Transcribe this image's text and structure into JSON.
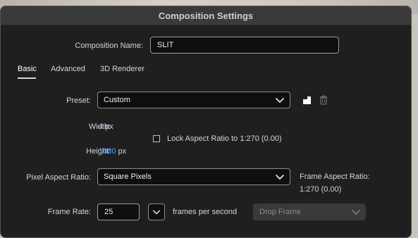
{
  "window": {
    "title": "Composition Settings"
  },
  "composition": {
    "name_label": "Composition Name:",
    "name_value": "SLIT"
  },
  "tabs": [
    {
      "label": "Basic",
      "active": true
    },
    {
      "label": "Advanced",
      "active": false
    },
    {
      "label": "3D Renderer",
      "active": false
    }
  ],
  "preset": {
    "label": "Preset:",
    "value": "Custom",
    "save_icon": "save-preset-icon",
    "delete_icon": "trash-icon"
  },
  "size": {
    "width_label": "Width:",
    "width_value": "4",
    "width_unit": "px",
    "height_label": "Height:",
    "height_value": "1080",
    "height_unit": "px",
    "lock_label": "Lock Aspect Ratio to 1:270 (0.00)",
    "lock_checked": false
  },
  "pixel_aspect": {
    "label": "Pixel Aspect Ratio:",
    "value": "Square Pixels"
  },
  "frame_aspect": {
    "label": "Frame Aspect Ratio:",
    "value": "1:270 (0.00)"
  },
  "frame_rate": {
    "label": "Frame Rate:",
    "value": "25",
    "units": "frames per second",
    "drop_frame": "Drop Frame"
  },
  "colors": {
    "accent_blue": "#5aa0ff"
  }
}
